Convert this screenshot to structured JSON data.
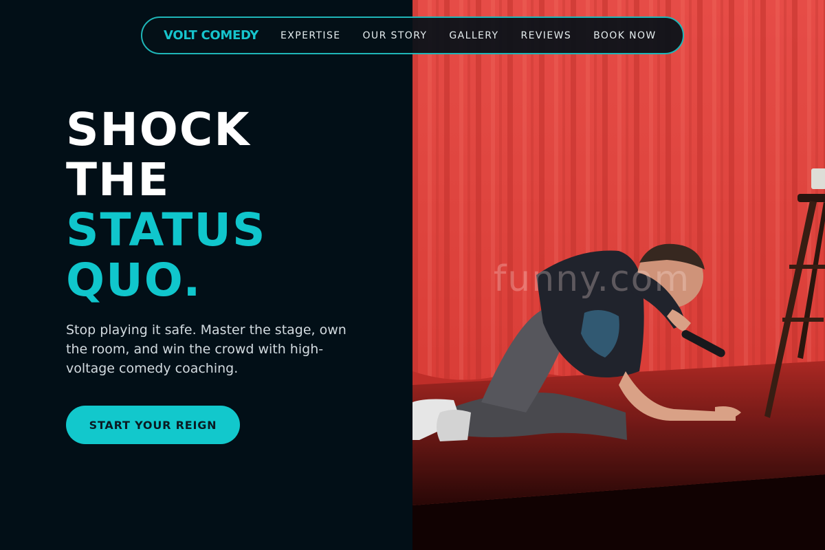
{
  "nav": {
    "brand": "VOLT COMEDY",
    "links": [
      "EXPERTISE",
      "OUR STORY",
      "GALLERY",
      "REVIEWS",
      "BOOK NOW"
    ]
  },
  "hero": {
    "title_white_1": "SHOCK",
    "title_white_2": "THE",
    "title_accent_1": "STATUS",
    "title_accent_2": "QUO.",
    "subtitle": "Stop playing it safe. Master the stage, own the room, and win the crowd with high-voltage comedy coaching.",
    "cta_label": "START YOUR REIGN"
  },
  "photo": {
    "watermark": "funny.com",
    "alt": "Comedian on stage in front of red curtain",
    "description_icon": "stage-photo"
  },
  "colors": {
    "accent": "#12c8cc",
    "background": "#020f17",
    "curtain": "#e4443a"
  }
}
